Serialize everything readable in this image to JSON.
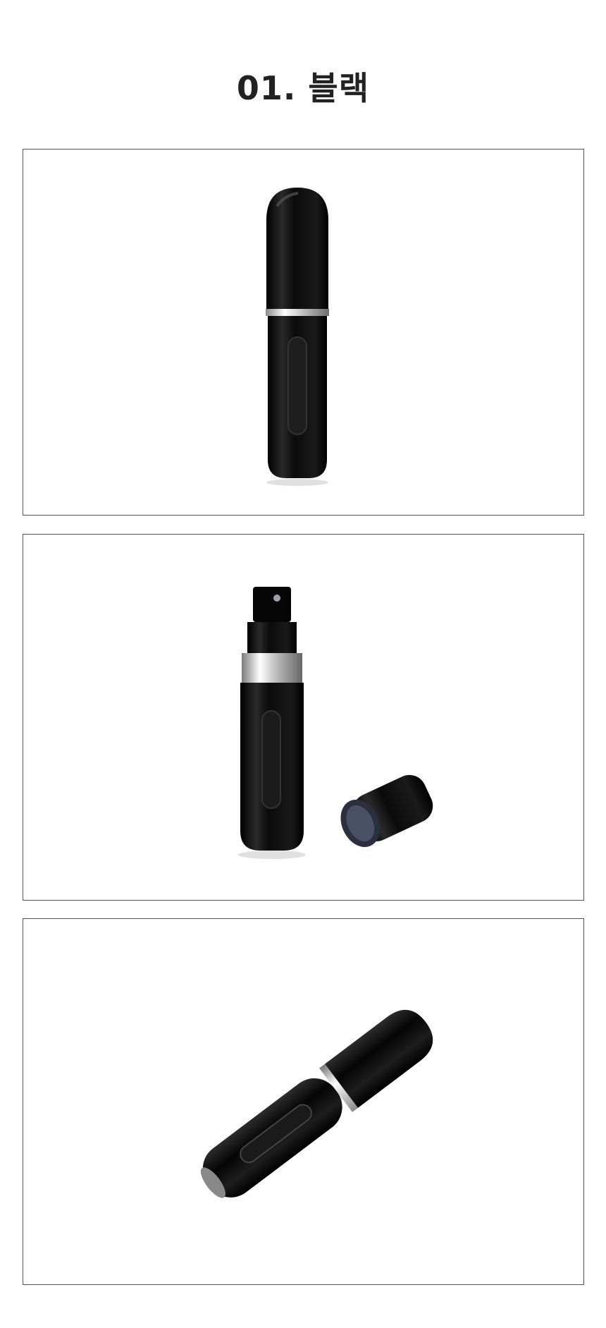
{
  "heading": {
    "title": "01. 블랙"
  },
  "product": {
    "color": "#0a0a0a",
    "accent": "#c8c8c8"
  },
  "photos": [
    {
      "name": "closed-atomizer-upright"
    },
    {
      "name": "open-atomizer-with-cap"
    },
    {
      "name": "atomizer-lying-diagonal"
    }
  ]
}
